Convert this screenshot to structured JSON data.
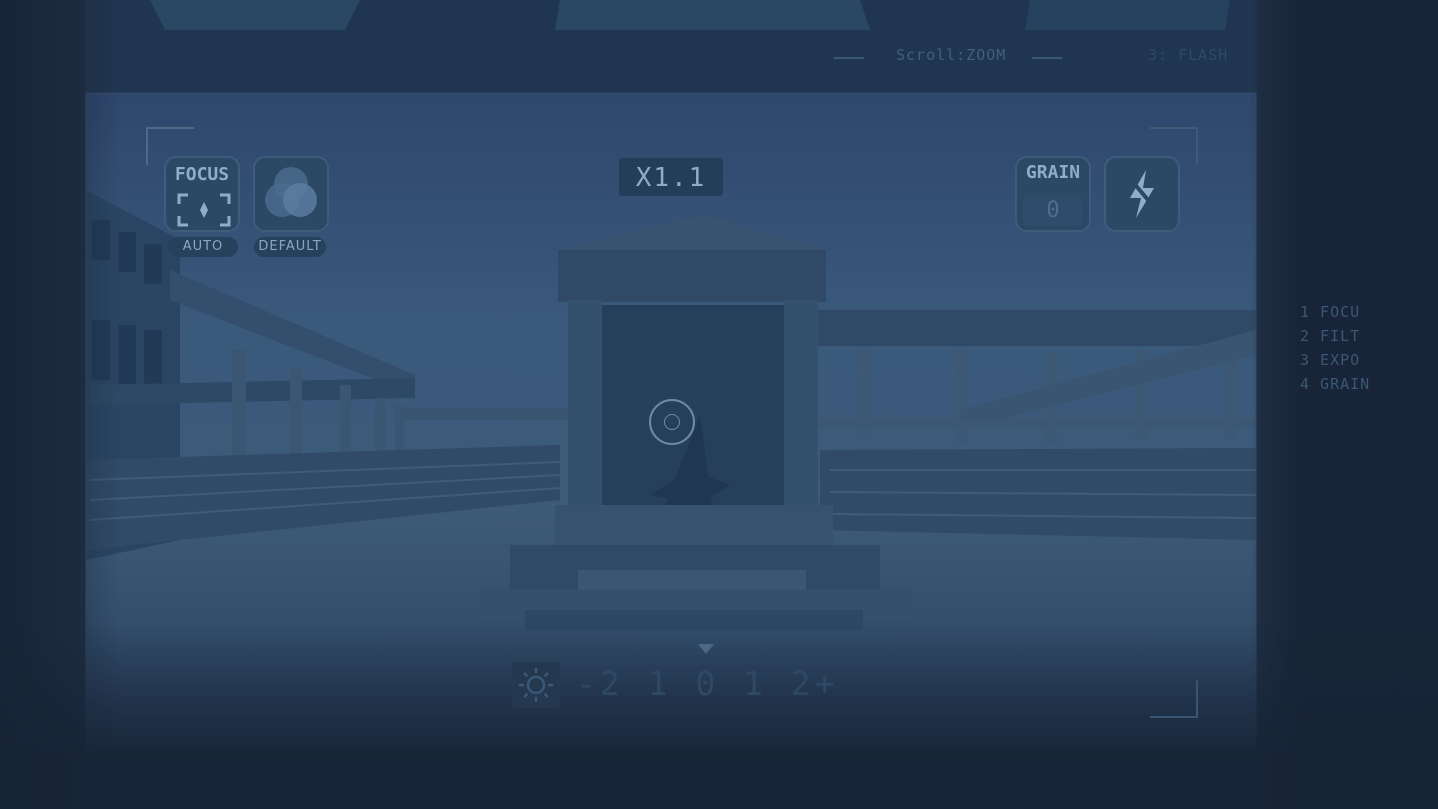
{
  "top_hints": {
    "zoom": "Scroll:ZOOM",
    "flash": "3: FLASH"
  },
  "hud": {
    "zoom_level": "X1.1",
    "focus": {
      "label": "FOCUS",
      "mode": "AUTO"
    },
    "filter": {
      "mode": "DEFAULT"
    },
    "grain": {
      "label": "GRAIN",
      "value": "0"
    },
    "flash_icon": "lightning-off-icon",
    "focus_icon": "focus-bracket-icon",
    "filter_icon": "venn-filter-icon"
  },
  "exposure": {
    "icon": "sun-icon",
    "scale": "-2 1 0 1 2+"
  },
  "side_menu": {
    "items": [
      "1 FOCU",
      "2 FILT",
      "3 EXPO",
      "4 GRAIN"
    ]
  },
  "colors": {
    "background": "#1c2b3f",
    "viewfinder": "#2e4b6b",
    "hud_accent": "#8fadc8"
  }
}
